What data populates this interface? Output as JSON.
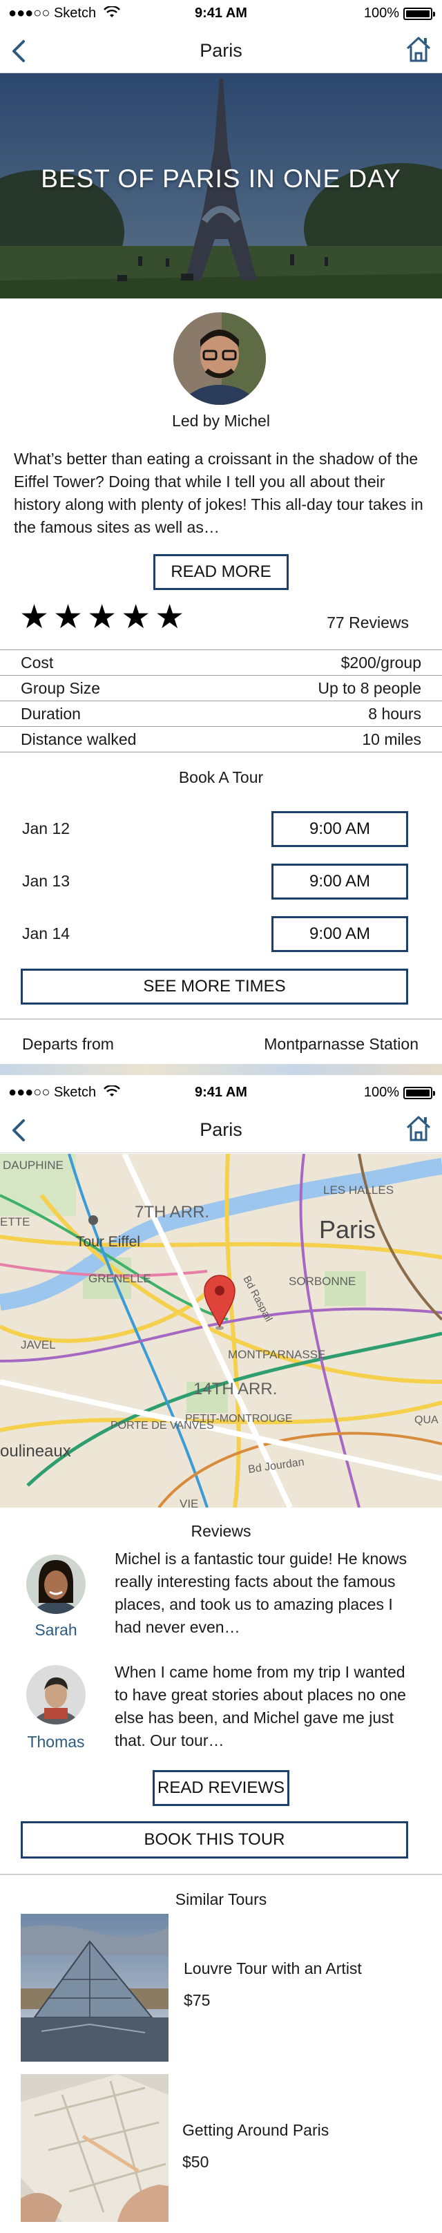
{
  "status_bar": {
    "carrier": "●●●○○ Sketch",
    "time": "9:41 AM",
    "battery": "100%"
  },
  "nav": {
    "title": "Paris"
  },
  "hero": {
    "title": "BEST OF PARIS IN ONE DAY"
  },
  "guide": {
    "led_by": "Led by Michel"
  },
  "description": "What’s better than eating a croissant in the shadow of the Eiffel Tower? Doing that while I tell you all about their history along with plenty of jokes! This all-day tour takes in the famous sites as well as…",
  "read_more": "READ MORE",
  "rating": {
    "stars": 5,
    "max": 5,
    "reviews": "77 Reviews"
  },
  "details": [
    {
      "label": "Cost",
      "value": "$200/group"
    },
    {
      "label": "Group Size",
      "value": "Up to 8 people"
    },
    {
      "label": "Duration",
      "value": "8 hours"
    },
    {
      "label": "Distance walked",
      "value": "10 miles"
    }
  ],
  "booking": {
    "title": "Book A Tour",
    "slots": [
      {
        "date": "Jan 12",
        "time": "9:00 AM"
      },
      {
        "date": "Jan 13",
        "time": "9:00 AM"
      },
      {
        "date": "Jan 14",
        "time": "9:00 AM"
      }
    ],
    "see_more": "SEE MORE TIMES"
  },
  "departs": {
    "label": "Departs from",
    "value": "Montparnasse Station"
  },
  "map": {
    "labels": [
      "DAUPHINE",
      "LES HALLES",
      "7TH ARR.",
      "Paris",
      "ETTE",
      "Tour Eiffel",
      "GRENELLE",
      "SORBONNE",
      "JAVEL",
      "MONTPARNASSE",
      "14TH ARR.",
      "PORTE DE VANVES",
      "PETIT-MONTROUGE",
      "QUA",
      "oulineaux",
      "Bd Jourdan",
      "Bd Raspail",
      "VIE"
    ]
  },
  "reviews": {
    "title": "Reviews",
    "items": [
      {
        "name": "Sarah",
        "text": "Michel is a fantastic tour guide! He knows really interesting facts about the famous places, and took us to amazing places I had never even…"
      },
      {
        "name": "Thomas",
        "text": "When I came home from my trip I wanted to have great stories about places no one else has been, and Michel gave me just that. Our tour…"
      }
    ],
    "read_reviews": "READ REVIEWS"
  },
  "book_tour": "BOOK THIS TOUR",
  "similar": {
    "title": "Similar Tours",
    "items": [
      {
        "name": "Louvre Tour with an Artist",
        "price": "$75"
      },
      {
        "name": "Getting Around Paris",
        "price": "$50"
      }
    ]
  },
  "colors": {
    "accent": "#1d3f69",
    "nav_blue": "#2d5a80",
    "pin": "#e0433a"
  }
}
